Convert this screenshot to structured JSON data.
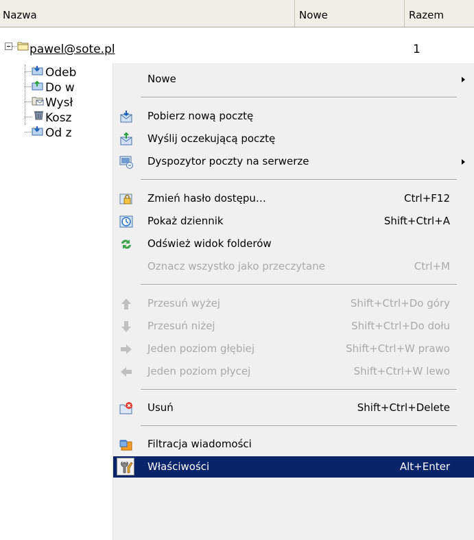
{
  "columns": {
    "name": "Nazwa",
    "new": "Nowe",
    "total": "Razem"
  },
  "tree": {
    "root": {
      "label": "pawel@sote.pl",
      "count": "1"
    },
    "children": [
      {
        "label": "Odeb",
        "icon": "inbox-folder-icon"
      },
      {
        "label": "Do w",
        "icon": "outbox-folder-icon"
      },
      {
        "label": "Wysł",
        "icon": "sent-folder-icon"
      },
      {
        "label": "Kosz",
        "icon": "trash-icon"
      },
      {
        "label": "Od z",
        "icon": "inbox-folder-icon"
      }
    ]
  },
  "colors": {
    "menu_bg": "#f0f0f0",
    "selection": "#0a246a",
    "disabled_text": "#a9a9a9"
  },
  "menu": {
    "items": [
      {
        "label": "Nowe",
        "shortcut": "",
        "submenu": true
      },
      {
        "label": "Pobierz nową pocztę",
        "shortcut": "",
        "icon": "download-mail-icon"
      },
      {
        "label": "Wyślij oczekującą pocztę",
        "shortcut": "",
        "icon": "upload-mail-icon"
      },
      {
        "label": "Dyspozytor poczty na serwerze",
        "shortcut": "",
        "icon": "server-mail-icon",
        "submenu": true
      },
      {
        "label": "Zmień hasło dostępu…",
        "shortcut": "Ctrl+F12",
        "icon": "lock-icon"
      },
      {
        "label": "Pokaż dziennik",
        "shortcut": "Shift+Ctrl+A",
        "icon": "log-icon"
      },
      {
        "label": "Odśwież widok folderów",
        "shortcut": "",
        "icon": "refresh-icon"
      },
      {
        "label": "Oznacz wszystko jako przeczytane",
        "shortcut": "Ctrl+M",
        "disabled": true
      },
      {
        "label": "Przesuń wyżej",
        "shortcut": "Shift+Ctrl+Do góry",
        "icon": "arrow-up-icon",
        "disabled": true
      },
      {
        "label": "Przesuń niżej",
        "shortcut": "Shift+Ctrl+Do dołu",
        "icon": "arrow-down-icon",
        "disabled": true
      },
      {
        "label": "Jeden poziom głębiej",
        "shortcut": "Shift+Ctrl+W prawo",
        "icon": "arrow-right-icon",
        "disabled": true
      },
      {
        "label": "Jeden poziom płycej",
        "shortcut": "Shift+Ctrl+W lewo",
        "icon": "arrow-left-icon",
        "disabled": true
      },
      {
        "label": "Usuń",
        "shortcut": "Shift+Ctrl+Delete",
        "icon": "delete-folder-icon"
      },
      {
        "label": "Filtracja wiadomości",
        "shortcut": "",
        "icon": "filter-icon"
      },
      {
        "label": "Właściwości",
        "shortcut": "Alt+Enter",
        "icon": "properties-icon",
        "selected": true
      }
    ]
  }
}
